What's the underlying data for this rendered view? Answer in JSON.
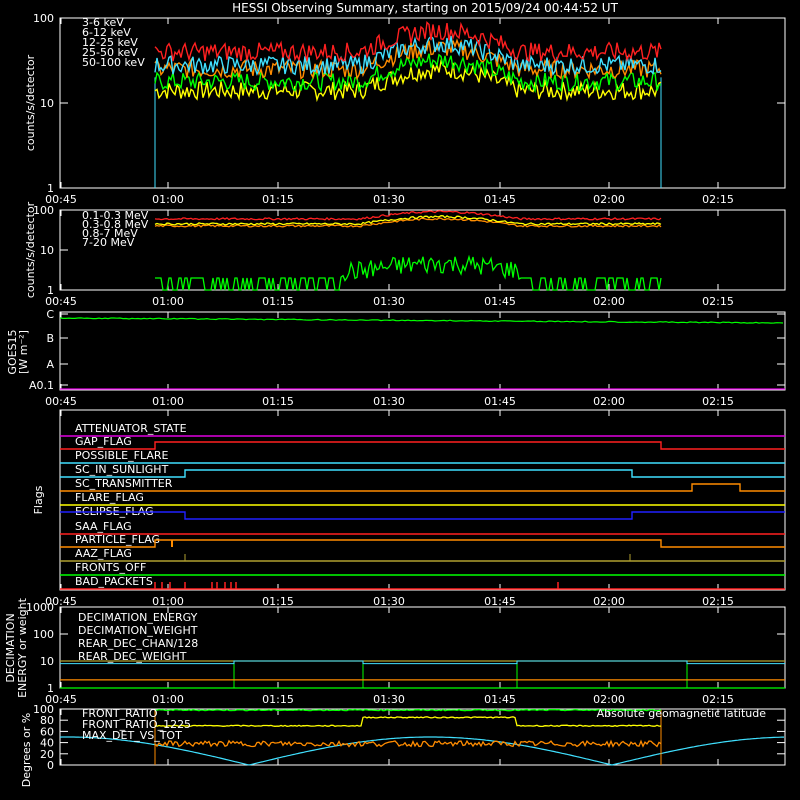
{
  "title": "HESSI Observing Summary, starting on 2015/09/24 00:44:52 UT",
  "time_ticks": [
    "00:45",
    "01:00",
    "01:15",
    "01:30",
    "01:45",
    "02:00",
    "02:15"
  ],
  "colors": {
    "red": "#ff2020",
    "orange": "#ff8c00",
    "yellow": "#ffff00",
    "green": "#00ff00",
    "cyan": "#40e0ff",
    "magenta": "#e000e0",
    "blue": "#2020ff",
    "olive": "#b0a030",
    "frame": "#ffffff"
  },
  "chart_data": [
    {
      "type": "line",
      "ylabel": "counts/s/detector",
      "ylim": [
        1,
        100
      ],
      "y_ticks": [
        "1",
        "10",
        "100"
      ],
      "yscale": "log",
      "x_window": [
        "00:58",
        "02:07"
      ],
      "series": [
        {
          "name": "3-6 keV",
          "color": "#ff2020",
          "approx_level": 40
        },
        {
          "name": "6-12 keV",
          "color": "#ff8c00",
          "approx_level": 25
        },
        {
          "name": "12-25 keV",
          "color": "#ffff00",
          "approx_level": 14
        },
        {
          "name": "25-50 keV",
          "color": "#00ff00",
          "approx_level": 18
        },
        {
          "name": "50-100 keV",
          "color": "#40e0ff",
          "approx_level": 28
        }
      ]
    },
    {
      "type": "line",
      "ylabel": "counts/s/detector",
      "ylim": [
        1,
        100
      ],
      "y_ticks": [
        "1",
        "10",
        "100"
      ],
      "yscale": "log",
      "series": [
        {
          "name": "0.1-0.3 MeV",
          "color": "#ff2020",
          "approx_level": 60
        },
        {
          "name": "0.3-0.8 MeV",
          "color": "#ff8c00",
          "approx_level": 40
        },
        {
          "name": "0.8-7 MeV",
          "color": "#ffff00",
          "approx_level": 45
        },
        {
          "name": "7-20 MeV",
          "color": "#00ff00",
          "approx_level": 3
        }
      ]
    },
    {
      "type": "line",
      "ylabel": "GOES15",
      "yunit": "[W m⁻²]",
      "y_ticks": [
        "A0.1",
        "A",
        "B",
        "C"
      ],
      "series": [
        {
          "name": "",
          "color": "#00ff00"
        }
      ]
    },
    {
      "type": "table",
      "ylabel": "Flags",
      "flags": [
        {
          "name": "ATTENUATOR_STATE",
          "color": "#e000e0"
        },
        {
          "name": "GAP_FLAG",
          "color": "#ff2020"
        },
        {
          "name": "POSSIBLE_FLARE",
          "color": "#40e0ff"
        },
        {
          "name": "SC_IN_SUNLIGHT",
          "color": "#40e0ff"
        },
        {
          "name": "SC_TRANSMITTER",
          "color": "#ff8c00"
        },
        {
          "name": "FLARE_FLAG",
          "color": "#ffff00"
        },
        {
          "name": "ECLIPSE_FLAG",
          "color": "#2020ff"
        },
        {
          "name": "SAA_FLAG",
          "color": "#ff2020"
        },
        {
          "name": "PARTICLE_FLAG",
          "color": "#ff8c00"
        },
        {
          "name": "AAZ_FLAG",
          "color": "#b0a030"
        },
        {
          "name": "FRONTS_OFF",
          "color": "#00ff00"
        },
        {
          "name": "BAD_PACKETS",
          "color": "#ff2020"
        }
      ]
    },
    {
      "type": "line",
      "ylabel": "DECIMATION\nENERGY or weight",
      "y_ticks": [
        "1",
        "10",
        "100",
        "1000"
      ],
      "yscale": "log",
      "series": [
        {
          "name": "DECIMATION_ENERGY",
          "color": "#00ff00"
        },
        {
          "name": "DECIMATION_WEIGHT",
          "color": "#ff8c00"
        },
        {
          "name": "REAR_DEC_CHAN/128",
          "color": "#40e0ff"
        },
        {
          "name": "REAR_DEC_WEIGHT",
          "color": "#b0a030"
        }
      ]
    },
    {
      "type": "line",
      "ylabel": "Degrees or %",
      "ylim": [
        0,
        100
      ],
      "y_ticks": [
        "0",
        "20",
        "40",
        "60",
        "80",
        "100"
      ],
      "series": [
        {
          "name": "FRONT_RATIO",
          "color": "#00ff00",
          "approx_level": 98
        },
        {
          "name": "FRONT_RATIO_1225",
          "color": "#ffff00",
          "approx_level": 78
        },
        {
          "name": "MAX_DET_VS_TOT",
          "color": "#ff8c00",
          "approx_level": 40
        },
        {
          "name": "Absolute geomagnetic latitude",
          "color": "#40e0ff"
        }
      ]
    }
  ]
}
